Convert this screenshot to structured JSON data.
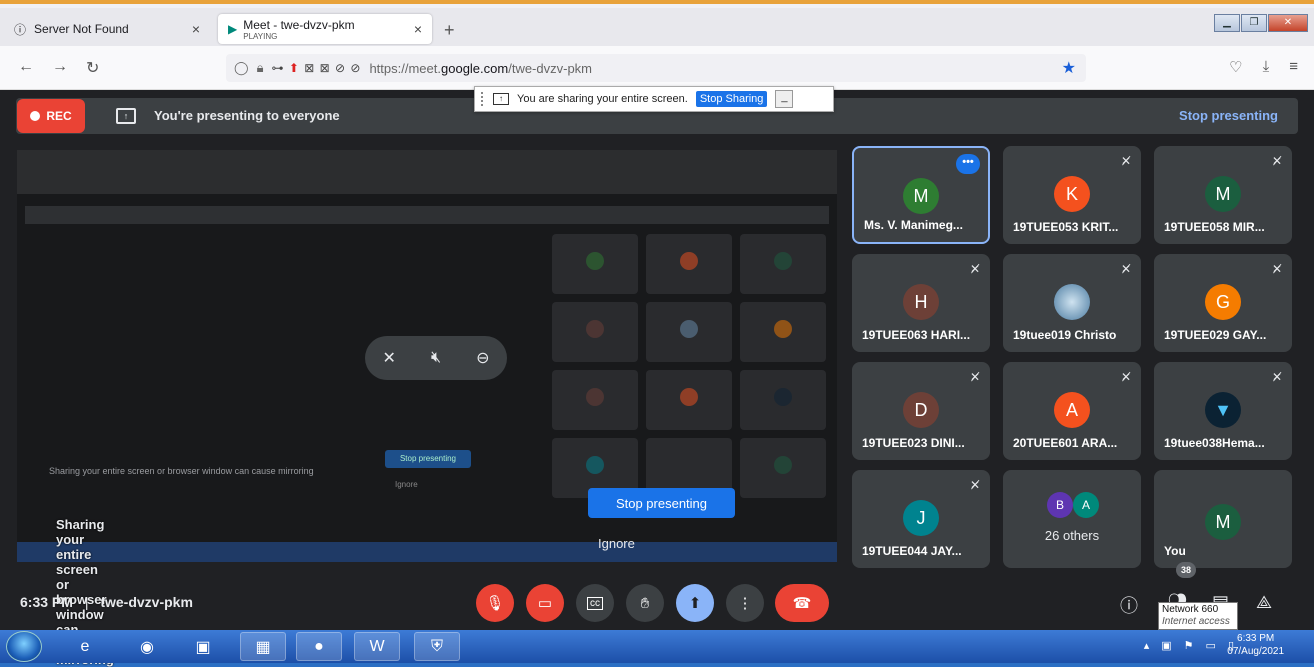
{
  "browser": {
    "tabs": [
      {
        "title": "Server Not Found",
        "close": "×"
      },
      {
        "title": "Meet - twe-dvzv-pkm",
        "subtitle": "PLAYING",
        "close": "×"
      }
    ],
    "new_tab": "+",
    "url_prefix": "https://meet.",
    "url_host": "google.com",
    "url_path": "/twe-dvzv-pkm"
  },
  "sharing_bar": {
    "text": "You are sharing your entire screen.",
    "button": "Stop Sharing",
    "minimize": "_"
  },
  "meet": {
    "rec_label": "REC",
    "presenting_text": "You're presenting to everyone",
    "stop_presenting_link": "Stop presenting",
    "mirror_warning": "Sharing your entire screen or browser window can cause mirroring",
    "stop_presenting_button": "Stop presenting",
    "ignore": "Ignore",
    "time": "6:33 PM",
    "separator": "|",
    "meeting_code": "twe-dvzv-pkm",
    "people_count": "38"
  },
  "participants": [
    {
      "initial": "M",
      "name": "Ms. V. Manimeg...",
      "color": "#2e7d32"
    },
    {
      "initial": "K",
      "name": "19TUEE053 KRIT...",
      "color": "#f4511e"
    },
    {
      "initial": "M",
      "name": "19TUEE058 MIR...",
      "color": "#1b5e3f"
    },
    {
      "initial": "H",
      "name": "19TUEE063 HARI...",
      "color": "#6d4037"
    },
    {
      "initial": "",
      "name": "19tuee019 Christo",
      "color": "#6a8fb0"
    },
    {
      "initial": "G",
      "name": "19TUEE029 GAY...",
      "color": "#f57c00"
    },
    {
      "initial": "D",
      "name": "19TUEE023 DINI...",
      "color": "#6d4037"
    },
    {
      "initial": "A",
      "name": "20TUEE601 ARA...",
      "color": "#f4511e"
    },
    {
      "initial": "",
      "name": "19tuee038Hema...",
      "color": "#0b2233"
    },
    {
      "initial": "J",
      "name": "19TUEE044 JAY...",
      "color": "#00838f"
    },
    {
      "initial": "",
      "name": "You",
      "color": "#1b5e3f",
      "you_initial": "M"
    }
  ],
  "others_tile": {
    "a1": "B",
    "a2": "A",
    "label": "26 others",
    "c1": "#5e35b1",
    "c2": "#00897b"
  },
  "more_options": "•••",
  "tooltip": {
    "line1": "Network  660",
    "line2": "Internet access"
  },
  "clock": {
    "time": "6:33 PM",
    "date": "07/Aug/2021"
  }
}
